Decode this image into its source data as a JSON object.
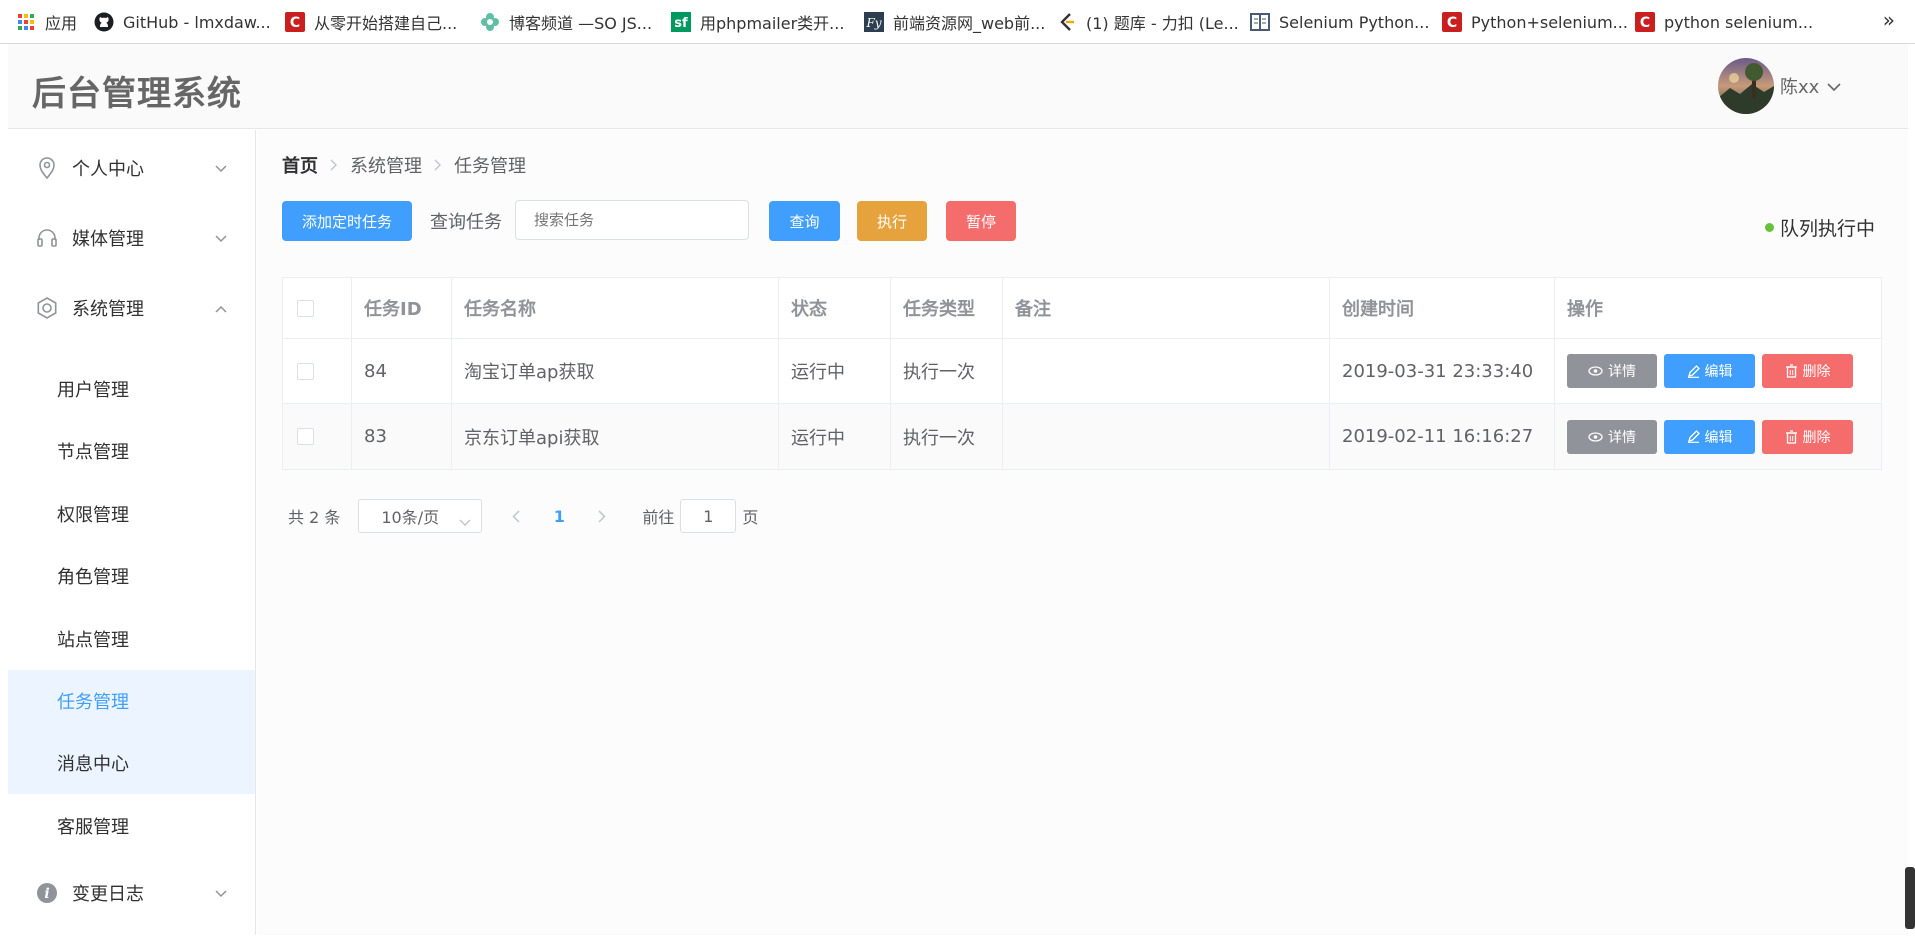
{
  "bookmarks": [
    {
      "label": "应用",
      "icon": "apps-grid-icon"
    },
    {
      "label": "GitHub - lmxdaw...",
      "icon": "github-icon"
    },
    {
      "label": "从零开始搭建自己...",
      "icon": "csdn-icon"
    },
    {
      "label": "博客频道 —SO JS...",
      "icon": "flower-icon"
    },
    {
      "label": "用phpmailer类开...",
      "icon": "sf-icon"
    },
    {
      "label": "前端资源网_web前...",
      "icon": "fy-icon"
    },
    {
      "label": "(1) 题库 - 力扣 (Le...",
      "icon": "leetcode-icon"
    },
    {
      "label": "Selenium Python...",
      "icon": "book-icon"
    },
    {
      "label": "Python+selenium...",
      "icon": "csdn-icon"
    },
    {
      "label": "python selenium...",
      "icon": "csdn-icon"
    }
  ],
  "bookmarks_more": "»",
  "header": {
    "title": "后台管理系统",
    "username": "陈xx"
  },
  "sidebar": {
    "groups": [
      {
        "label": "个人中心",
        "icon": "location-icon",
        "expanded": false
      },
      {
        "label": "媒体管理",
        "icon": "headset-icon",
        "expanded": false
      },
      {
        "label": "系统管理",
        "icon": "gear-icon",
        "expanded": true
      },
      {
        "label": "变更日志",
        "icon": "info-icon",
        "expanded": false
      }
    ],
    "sub_items": [
      {
        "label": "用户管理"
      },
      {
        "label": "节点管理"
      },
      {
        "label": "权限管理"
      },
      {
        "label": "角色管理"
      },
      {
        "label": "站点管理"
      },
      {
        "label": "任务管理"
      },
      {
        "label": "消息中心"
      },
      {
        "label": "客服管理"
      }
    ]
  },
  "breadcrumb": [
    "首页",
    "系统管理",
    "任务管理"
  ],
  "toolbar": {
    "add_label": "添加定时任务",
    "query_label": "查询任务",
    "search_placeholder": "搜索任务",
    "search_button": "查询",
    "execute_button": "执行",
    "pause_button": "暂停",
    "queue_status": "队列执行中"
  },
  "table": {
    "headers": [
      "任务ID",
      "任务名称",
      "状态",
      "任务类型",
      "备注",
      "创建时间",
      "操作"
    ],
    "rows": [
      {
        "id": "84",
        "name": "淘宝订单ap获取",
        "status": "运行中",
        "type": "执行一次",
        "note": "",
        "created": "2019-03-31 23:33:40"
      },
      {
        "id": "83",
        "name": "京东订单api获取",
        "status": "运行中",
        "type": "执行一次",
        "note": "",
        "created": "2019-02-11 16:16:27"
      }
    ],
    "actions": {
      "detail": "详情",
      "edit": "编辑",
      "delete": "删除"
    }
  },
  "pagination": {
    "total": "共 2 条",
    "page_size": "10条/页",
    "current_page": "1",
    "goto_label": "前往",
    "goto_value": "1",
    "page_unit": "页"
  },
  "colors": {
    "primary": "#409eff",
    "warning": "#e6a23c",
    "danger": "#f56c6c",
    "info": "#909399",
    "success": "#67c23a",
    "active_bg": "#ecf5ff"
  }
}
